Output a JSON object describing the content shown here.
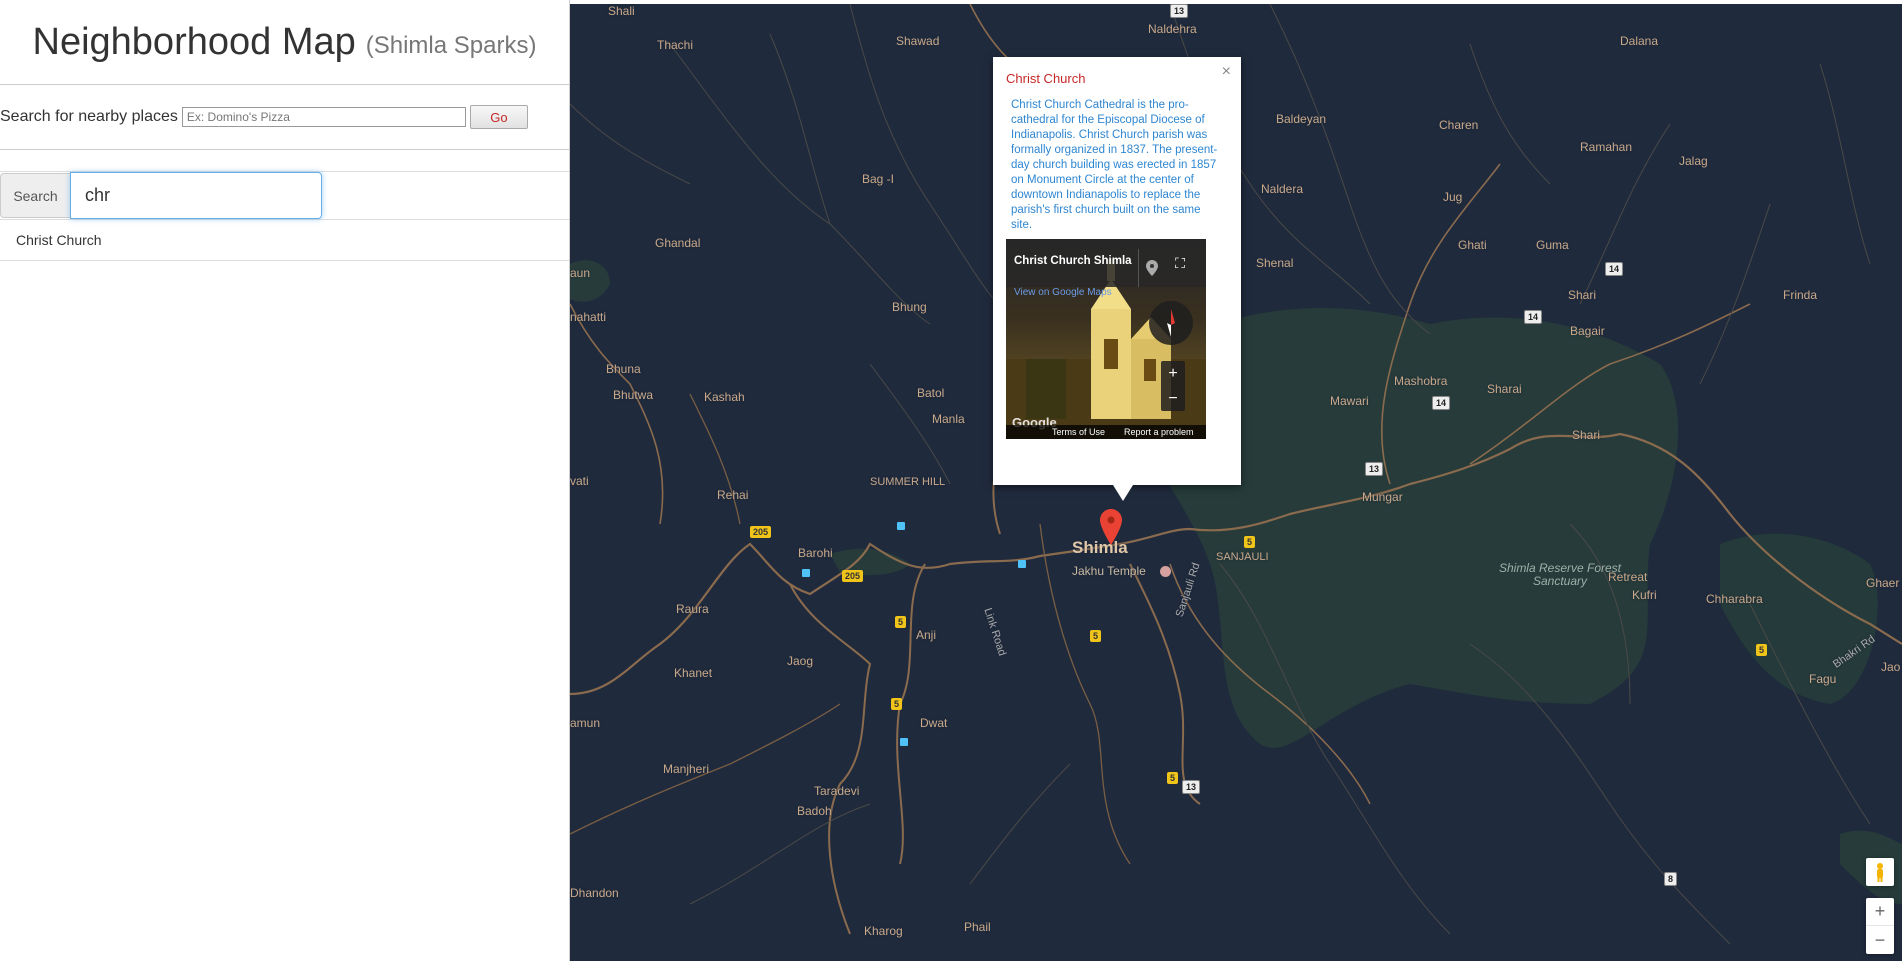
{
  "header": {
    "title": "Neighborhood Map",
    "subtitle": "(Shimla Sparks)"
  },
  "nearby": {
    "label": "Search for nearby places",
    "placeholder": "Ex: Domino's Pizza",
    "button": "Go"
  },
  "search": {
    "label": "Search",
    "value": "chr"
  },
  "results": [
    {
      "label": "Christ Church"
    }
  ],
  "colors": {
    "map_bg": "#1f2a3c",
    "accent_red": "#c62828",
    "link_blue": "#2e86d1",
    "highway_yellow": "#f0c419"
  },
  "map": {
    "places": [
      "Shali",
      "Thachi",
      "Shawad",
      "Naldehra",
      "Dalana",
      "Baldeyan",
      "Charen",
      "Ramahan",
      "Jalag",
      "Naldera",
      "Jug",
      "Bag -I",
      "Ghandal",
      "Ghati",
      "Guma",
      "Shenal",
      "Shari",
      "Frinda",
      "Bhung",
      "Bagair",
      "Mashobra",
      "Sharai",
      "Mawari",
      "Shari",
      "Bhuna",
      "Bhutwa",
      "Kashah",
      "Batol",
      "Manla",
      "Rehai",
      "SUMMER HILL",
      "Mungar",
      "Barohi",
      "Shimla",
      "Jakhu Temple",
      "SANJAULI",
      "Retreat",
      "Kufri",
      "Chharabra",
      "Ghaer",
      "Raura",
      "Anji",
      "Khanet",
      "Jaog",
      "Fagu",
      "Jao",
      "Dwat",
      "Manjheri",
      "Taradevi",
      "Badoh",
      "Dhandon",
      "Kharog",
      "Phail",
      "amun",
      "aun",
      "nahatti",
      "vati"
    ],
    "road_labels": [
      "Link Road",
      "Sanjauli Rd",
      "Bhakri Rd"
    ],
    "highways": [
      "13",
      "14",
      "14",
      "14",
      "13",
      "205",
      "205",
      "5",
      "5",
      "5",
      "5",
      "5",
      "13",
      "8",
      "5"
    ],
    "forest": "Shimla Reserve Forest Sanctuary",
    "zoom_in": "+",
    "zoom_out": "−"
  },
  "info_window": {
    "title": "Christ Church",
    "description": "Christ Church Cathedral is the pro-cathedral for the Episcopal Diocese of Indianapolis. Christ Church parish was formally organized in 1837. The present-day church building was erected in 1857 on Monument Circle at the center of downtown Indianapolis to replace the parish's first church built on the same site.",
    "close": "×",
    "streetview": {
      "title": "Christ Church Shimla",
      "link": "View on Google Maps",
      "google": "Google",
      "terms": "Terms of Use",
      "report": "Report a problem",
      "zoom_in": "+",
      "zoom_out": "−"
    }
  }
}
